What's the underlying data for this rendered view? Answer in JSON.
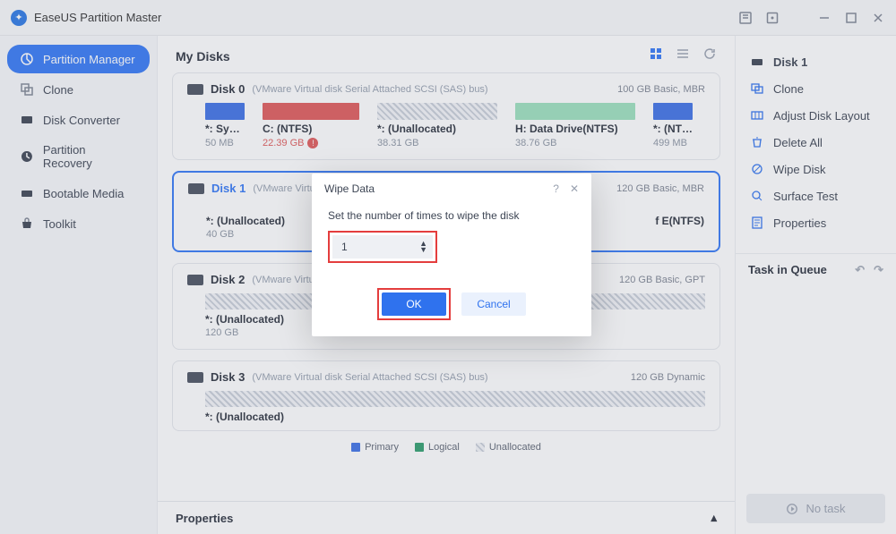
{
  "titlebar": {
    "app_name": "EaseUS Partition Master"
  },
  "sidebar": {
    "items": [
      {
        "label": "Partition Manager"
      },
      {
        "label": "Clone"
      },
      {
        "label": "Disk Converter"
      },
      {
        "label": "Partition Recovery"
      },
      {
        "label": "Bootable Media"
      },
      {
        "label": "Toolkit"
      }
    ]
  },
  "main": {
    "title": "My Disks",
    "disk0": {
      "name": "Disk 0",
      "meta": "(VMware   Virtual disk     Serial Attached SCSI (SAS) bus)",
      "cap": "100 GB Basic, MBR",
      "parts": [
        {
          "label": "*: Syst…",
          "size": "50 MB"
        },
        {
          "label": "C: (NTFS)",
          "size": "22.39 GB"
        },
        {
          "label": "*: (Unallocated)",
          "size": "38.31 GB"
        },
        {
          "label": "H: Data Drive(NTFS)",
          "size": "38.76 GB"
        },
        {
          "label": "*: (NT…",
          "size": "499 MB"
        }
      ]
    },
    "disk1": {
      "name": "Disk 1",
      "meta": "(VMware   Virtu",
      "cap": "120 GB Basic, MBR",
      "sub_label": "*: (Unallocated)",
      "sub_size": "40 GB",
      "right_frag": "f E(NTFS)"
    },
    "disk2": {
      "name": "Disk 2",
      "meta": "(VMware   Virtu",
      "cap": "120 GB Basic, GPT",
      "sub_label": "*: (Unallocated)",
      "sub_size": "120 GB"
    },
    "disk3": {
      "name": "Disk 3",
      "meta": "(VMware   Virtual disk     Serial Attached SCSI (SAS) bus)",
      "cap": "120 GB Dynamic",
      "sub_label": "*: (Unallocated)"
    },
    "legend": {
      "primary": "Primary",
      "logical": "Logical",
      "unallocated": "Unallocated"
    },
    "properties": "Properties"
  },
  "rightpane": {
    "items": [
      {
        "label": "Disk 1"
      },
      {
        "label": "Clone"
      },
      {
        "label": "Adjust Disk Layout"
      },
      {
        "label": "Delete All"
      },
      {
        "label": "Wipe Disk"
      },
      {
        "label": "Surface Test"
      },
      {
        "label": "Properties"
      }
    ],
    "task_title": "Task in Queue",
    "no_task": "No task"
  },
  "modal": {
    "title": "Wipe Data",
    "label": "Set the number of times to wipe the disk",
    "value": "1",
    "ok": "OK",
    "cancel": "Cancel"
  }
}
